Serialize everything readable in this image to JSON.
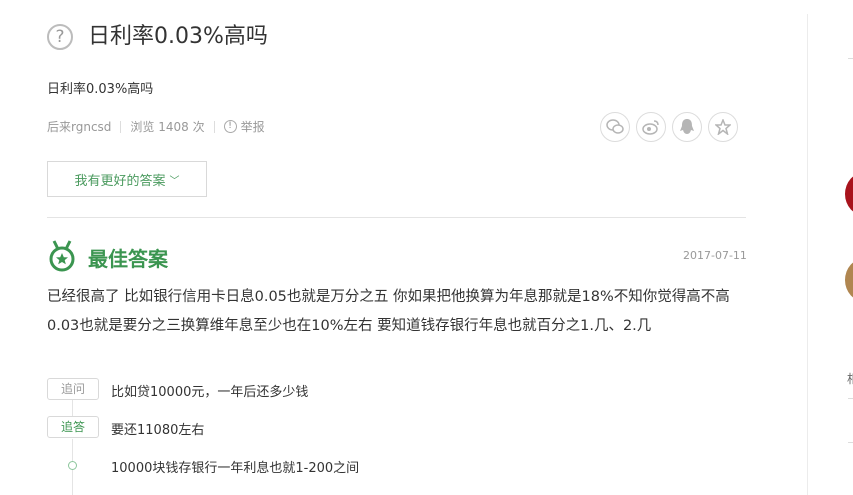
{
  "question": {
    "title": "日利率0.03%高吗",
    "description": "日利率0.03%高吗",
    "author": "后来rgncsd",
    "views": "浏览 1408 次",
    "report": "举报"
  },
  "share_icons": [
    "wechat-icon",
    "weibo-icon",
    "qq-icon",
    "favorite-star-icon"
  ],
  "better_answer_button": "我有更好的答案",
  "best_answer": {
    "heading": "最佳答案",
    "date": "2017-07-11",
    "body": "已经很高了 比如银行信用卡日息0.05也就是万分之五 你如果把他换算为年息那就是18%不知你觉得高不高 0.03也就是要分之三换算维年息至少也在10%左右 要知道钱存银行年息也就百分之1.几、2.几"
  },
  "followups": [
    {
      "tag": "追问",
      "text": "比如贷10000元，一年后还多少钱"
    },
    {
      "tag": "追答",
      "text": "要还11080左右"
    },
    {
      "tag": "",
      "text": "10000块钱存银行一年利息也就1-200之间"
    }
  ],
  "sidebar": {
    "edge_char": "相"
  },
  "colors": {
    "accent_green": "#3b9550",
    "muted_gray": "#999999"
  }
}
